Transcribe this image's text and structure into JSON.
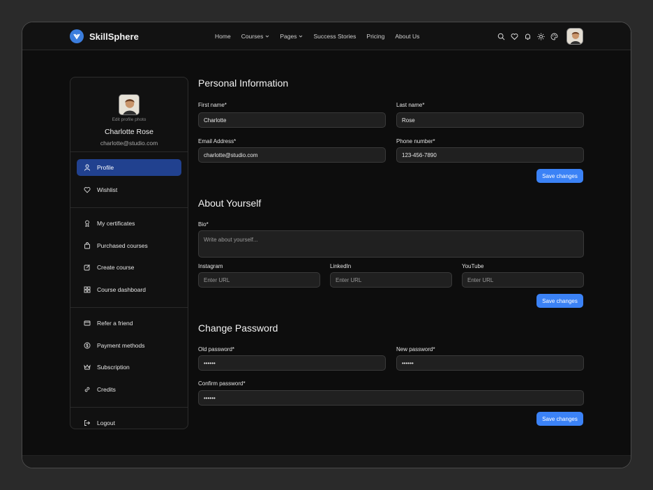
{
  "brand": {
    "name": "SkillSphere",
    "logo_icon": "v-badge-icon",
    "accent": "#3b7ddd"
  },
  "nav": [
    {
      "label": "Home",
      "dropdown": false
    },
    {
      "label": "Courses",
      "dropdown": true
    },
    {
      "label": "Pages",
      "dropdown": true
    },
    {
      "label": "Success Stories",
      "dropdown": false
    },
    {
      "label": "Pricing",
      "dropdown": false
    },
    {
      "label": "About Us",
      "dropdown": false
    }
  ],
  "header_icons": [
    "search-icon",
    "heart-icon",
    "bell-icon",
    "sun-icon",
    "palette-icon"
  ],
  "profile": {
    "edit_photo": "Edit profile photo",
    "name": "Charlotte Rose",
    "email": "charlotte@studio.com"
  },
  "sidebar": {
    "group1": [
      {
        "label": "Profile",
        "icon": "user-icon",
        "active": true
      },
      {
        "label": "Wishlist",
        "icon": "heart-icon",
        "active": false
      }
    ],
    "group2": [
      {
        "label": "My certificates",
        "icon": "award-icon"
      },
      {
        "label": "Purchased courses",
        "icon": "bag-icon"
      },
      {
        "label": "Create course",
        "icon": "edit-icon"
      },
      {
        "label": "Course dashboard",
        "icon": "grid-icon"
      }
    ],
    "group3": [
      {
        "label": "Refer a friend",
        "icon": "card-icon"
      },
      {
        "label": "Payment methods",
        "icon": "dollar-icon"
      },
      {
        "label": "Subscription",
        "icon": "crown-icon"
      },
      {
        "label": "Credits",
        "icon": "link-icon"
      }
    ],
    "group4": [
      {
        "label": "Logout",
        "icon": "logout-icon"
      }
    ]
  },
  "personal": {
    "title": "Personal Information",
    "first_name_label": "First name*",
    "first_name_value": "Charlotte",
    "last_name_label": "Last name*",
    "last_name_value": "Rose",
    "email_label": "Email Address*",
    "email_value": "charlotte@studio.com",
    "phone_label": "Phone number*",
    "phone_value": "123-456-7890",
    "save_label": "Save changes"
  },
  "about": {
    "title": "About Yourself",
    "bio_label": "Bio*",
    "bio_placeholder": "Write about yourself...",
    "instagram_label": "Instagram",
    "linkedin_label": "LinkedIn",
    "youtube_label": "YouTube",
    "url_placeholder": "Enter URL",
    "save_label": "Save changes"
  },
  "password": {
    "title": "Change Password",
    "old_label": "Old password*",
    "old_value": "••••••",
    "new_label": "New password*",
    "new_value": "••••••",
    "confirm_label": "Confirm password*",
    "confirm_value": "••••••",
    "save_label": "Save changes"
  }
}
